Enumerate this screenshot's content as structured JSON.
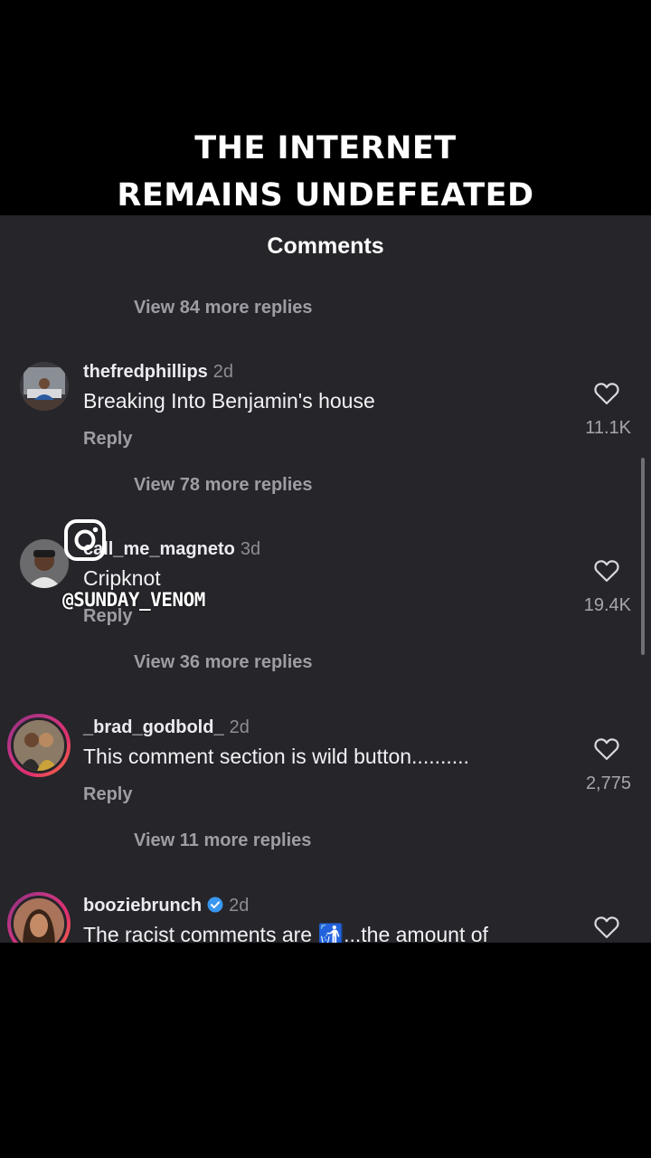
{
  "headline": {
    "line1": "THE INTERNET",
    "line2": "REMAINS UNDEFEATED"
  },
  "panel": {
    "title": "Comments"
  },
  "view_more": [
    "View 84 more replies",
    "View 78 more replies",
    "View 36 more replies",
    "View 11 more replies"
  ],
  "comments": [
    {
      "user": "thefredphillips",
      "time": "2d",
      "text": "Breaking Into Benjamin's house",
      "reply": "Reply",
      "likes": "11.1K"
    },
    {
      "user": "call_me_magneto",
      "time": "3d",
      "text": "Cripknot",
      "reply": "Reply",
      "likes": "19.4K"
    },
    {
      "user": "_brad_godbold_",
      "time": "2d",
      "text": "This comment section is wild button..........",
      "reply": "Reply",
      "likes": "2,775"
    },
    {
      "user": "booziebrunch",
      "time": "2d",
      "text": "The racist comments are 🚮...the amount of",
      "verified": true
    }
  ],
  "watermark": {
    "handle": "@SUNDAY_VENOM",
    "icon": "instagram-icon"
  },
  "colors": {
    "panel_bg": "#25252a",
    "muted_text": "#9d9da4",
    "verified_blue": "#3897f0",
    "story_ring": "#c13584"
  }
}
